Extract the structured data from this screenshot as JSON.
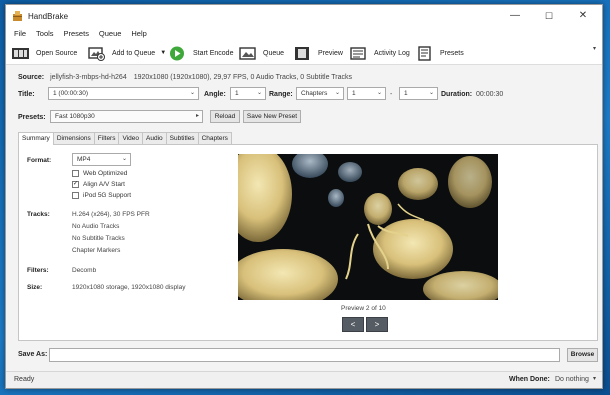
{
  "window": {
    "title": "HandBrake",
    "minimize": "—",
    "maximize": "☐",
    "close": "✕"
  },
  "menu": [
    "File",
    "Tools",
    "Presets",
    "Queue",
    "Help"
  ],
  "toolbar": {
    "open_source": "Open Source",
    "add_to_queue": "Add to Queue",
    "start_encode": "Start Encode",
    "queue": "Queue",
    "preview": "Preview",
    "activity_log": "Activity Log",
    "presets": "Presets"
  },
  "source": {
    "label": "Source:",
    "name": "jellyfish-3-mbps-hd-h264",
    "info": "1920x1080 (1920x1080), 29,97 FPS, 0 Audio Tracks, 0 Subtitle Tracks"
  },
  "title_row": {
    "title_label": "Title:",
    "title_value": "1 (00:00:30)",
    "angle_label": "Angle:",
    "angle_value": "1",
    "range_label": "Range:",
    "range_type": "Chapters",
    "range_start": "1",
    "range_sep": "-",
    "range_end": "1",
    "duration_label": "Duration:",
    "duration_value": "00:00:30"
  },
  "presets": {
    "label": "Presets:",
    "value": "Fast 1080p30",
    "reload": "Reload",
    "save_new": "Save New Preset"
  },
  "tabs": [
    "Summary",
    "Dimensions",
    "Filters",
    "Video",
    "Audio",
    "Subtitles",
    "Chapters"
  ],
  "summary": {
    "format_label": "Format:",
    "format_value": "MP4",
    "web_optimized": "Web Optimized",
    "align_av": "Align A/V Start",
    "ipod": "iPod 5G Support",
    "tracks_label": "Tracks:",
    "tracks": [
      "H.264 (x264), 30 FPS PFR",
      "No Audio Tracks",
      "No Subtitle Tracks",
      "Chapter Markers"
    ],
    "filters_label": "Filters:",
    "filters_value": "Decomb",
    "size_label": "Size:",
    "size_value": "1920x1080 storage, 1920x1080 display"
  },
  "preview": {
    "caption": "Preview 2 of 10",
    "prev": "<",
    "next": ">"
  },
  "save_as": {
    "label": "Save As:",
    "value": "",
    "browse": "Browse"
  },
  "status": {
    "text": "Ready",
    "when_done_label": "When Done:",
    "when_done_value": "Do nothing"
  }
}
